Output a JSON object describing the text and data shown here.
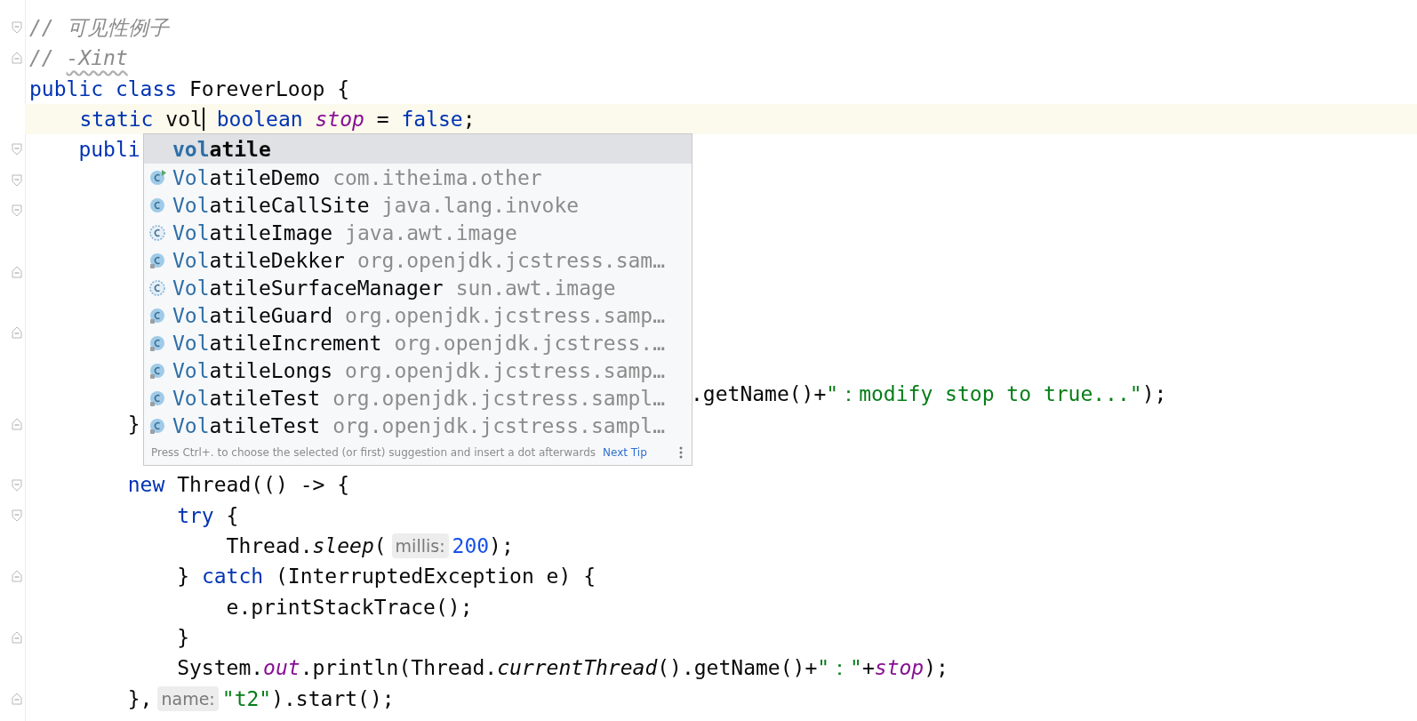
{
  "editor": {
    "lines": [
      {
        "kind": "fold-start",
        "tokens": [
          {
            "kind": "comment",
            "text": "// 可见性例子"
          }
        ]
      },
      {
        "kind": "fold-end",
        "tokens": [
          {
            "kind": "comment",
            "text": "// "
          },
          {
            "kind": "typo",
            "text": "-Xint"
          }
        ]
      },
      {
        "kind": "plain",
        "tokens": [
          {
            "kind": "kw",
            "text": "public class "
          },
          {
            "kind": "plain",
            "text": "ForeverLoop {"
          }
        ]
      },
      {
        "kind": "plain",
        "current": true,
        "tokens": [
          {
            "kind": "kw",
            "text": "    static "
          },
          {
            "kind": "typed",
            "text": "vol",
            "caret": true
          },
          {
            "kind": "kw",
            "text": " boolean "
          },
          {
            "kind": "field",
            "text": "stop"
          },
          {
            "kind": "plain",
            "text": " = "
          },
          {
            "kind": "kw",
            "text": "false"
          },
          {
            "kind": "plain",
            "text": ";"
          }
        ]
      },
      {
        "kind": "fold-start",
        "tokens": [
          {
            "kind": "kw",
            "text": "    publi"
          }
        ]
      },
      {
        "kind": "fold-start"
      },
      {
        "kind": "fold-start"
      },
      {
        "kind": "plain"
      },
      {
        "kind": "fold-end"
      },
      {
        "kind": "plain"
      },
      {
        "kind": "fold-end"
      },
      {
        "kind": "plain"
      },
      {
        "kind": "after-popup",
        "tokens": [
          {
            "kind": "plain",
            "text": ".getName()+"
          },
          {
            "kind": "str",
            "text": "\"：modify stop to true...\""
          },
          {
            "kind": "plain",
            "text": ");"
          }
        ]
      },
      {
        "kind": "fold-end",
        "tokens": [
          {
            "kind": "plain",
            "text": "        }"
          }
        ]
      },
      {
        "kind": "plain"
      },
      {
        "kind": "fold-start",
        "tokens": [
          {
            "kind": "kw",
            "text": "        new "
          },
          {
            "kind": "plain",
            "text": "Thread(() -> {"
          }
        ]
      },
      {
        "kind": "fold-start",
        "tokens": [
          {
            "kind": "kw",
            "text": "            try "
          },
          {
            "kind": "plain",
            "text": "{"
          }
        ]
      },
      {
        "kind": "plain",
        "tokens": [
          {
            "kind": "plain",
            "text": "                Thread."
          },
          {
            "kind": "smethod",
            "text": "sleep"
          },
          {
            "kind": "plain",
            "text": "("
          },
          {
            "kind": "hint",
            "text": "millis:"
          },
          {
            "kind": "num",
            "text": "200"
          },
          {
            "kind": "plain",
            "text": ");"
          }
        ]
      },
      {
        "kind": "fold-end",
        "tokens": [
          {
            "kind": "plain",
            "text": "            } "
          },
          {
            "kind": "kw",
            "text": "catch "
          },
          {
            "kind": "plain",
            "text": "(InterruptedException e) {"
          }
        ]
      },
      {
        "kind": "plain",
        "tokens": [
          {
            "kind": "plain",
            "text": "                e.printStackTrace();"
          }
        ]
      },
      {
        "kind": "fold-end",
        "tokens": [
          {
            "kind": "plain",
            "text": "            }"
          }
        ]
      },
      {
        "kind": "plain",
        "tokens": [
          {
            "kind": "plain",
            "text": "            System."
          },
          {
            "kind": "field",
            "text": "out"
          },
          {
            "kind": "plain",
            "text": ".println(Thread."
          },
          {
            "kind": "smethod",
            "text": "currentThread"
          },
          {
            "kind": "plain",
            "text": "().getName()+"
          },
          {
            "kind": "str",
            "text": "\"：\""
          },
          {
            "kind": "plain",
            "text": "+"
          },
          {
            "kind": "field",
            "text": "stop"
          },
          {
            "kind": "plain",
            "text": ");"
          }
        ]
      },
      {
        "kind": "fold-end",
        "tokens": [
          {
            "kind": "plain",
            "text": "        },"
          },
          {
            "kind": "hint",
            "text": "name:"
          },
          {
            "kind": "str",
            "text": "\"t2\""
          },
          {
            "kind": "plain",
            "text": ").start();"
          }
        ]
      }
    ]
  },
  "completion": {
    "items": [
      {
        "kind": "keyword",
        "name": "volatile",
        "selected": true
      },
      {
        "kind": "runnable-class",
        "name": "VolatileDemo",
        "package": "com.itheima.other",
        "selected": false
      },
      {
        "kind": "class",
        "name": "VolatileCallSite",
        "package": "java.lang.invoke",
        "selected": false
      },
      {
        "kind": "abstract-class",
        "name": "VolatileImage",
        "package": "java.awt.image",
        "selected": false
      },
      {
        "kind": "library-class",
        "name": "VolatileDekker",
        "package": "org.openjdk.jcstress.sam…",
        "selected": false
      },
      {
        "kind": "abstract-class",
        "name": "VolatileSurfaceManager",
        "package": "sun.awt.image",
        "selected": false
      },
      {
        "kind": "library-class",
        "name": "VolatileGuard",
        "package": "org.openjdk.jcstress.samp…",
        "selected": false
      },
      {
        "kind": "library-class",
        "name": "VolatileIncrement",
        "package": "org.openjdk.jcstress.…",
        "selected": false
      },
      {
        "kind": "library-class",
        "name": "VolatileLongs",
        "package": "org.openjdk.jcstress.samp…",
        "selected": false
      },
      {
        "kind": "library-class",
        "name": "VolatileTest",
        "package": "org.openjdk.jcstress.sampl…",
        "selected": false
      },
      {
        "kind": "library-class",
        "name": "VolatileTest",
        "package": "org.openjdk.jcstress.sampl…",
        "selected": false
      }
    ],
    "hint": "Press Ctrl+. to choose the selected (or first) suggestion and insert a dot afterwards",
    "link": "Next Tip"
  }
}
